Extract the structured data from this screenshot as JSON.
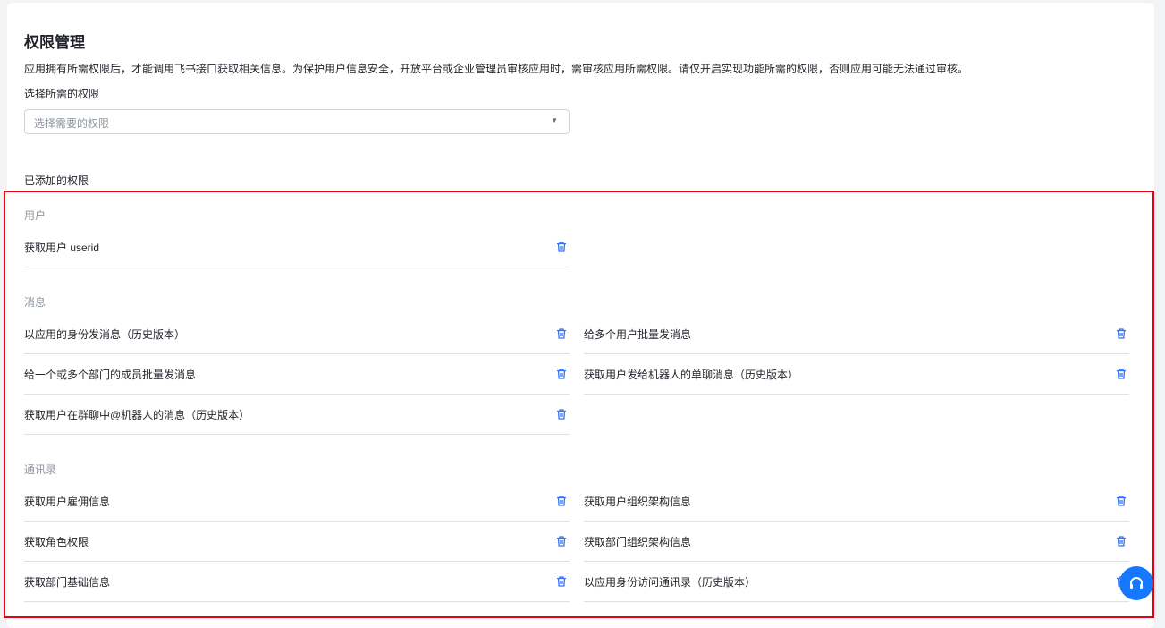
{
  "title": "权限管理",
  "description": "应用拥有所需权限后，才能调用飞书接口获取相关信息。为保护用户信息安全，开放平台或企业管理员审核应用时，需审核应用所需权限。请仅开启实现功能所需的权限，否则应用可能无法通过审核。",
  "select_label": "选择所需的权限",
  "select_placeholder": "选择需要的权限",
  "added_label": "已添加的权限",
  "sections": [
    {
      "label": "用户",
      "items": [
        "获取用户 userid"
      ]
    },
    {
      "label": "消息",
      "items": [
        "以应用的身份发消息（历史版本）",
        "给多个用户批量发消息",
        "给一个或多个部门的成员批量发消息",
        "获取用户发给机器人的单聊消息（历史版本）",
        "获取用户在群聊中@机器人的消息（历史版本）"
      ]
    },
    {
      "label": "通讯录",
      "items": [
        "获取用户雇佣信息",
        "获取用户组织架构信息",
        "获取角色权限",
        "获取部门组织架构信息",
        "获取部门基础信息",
        "以应用身份访问通讯录（历史版本）"
      ]
    }
  ],
  "accent": "#3370ff"
}
